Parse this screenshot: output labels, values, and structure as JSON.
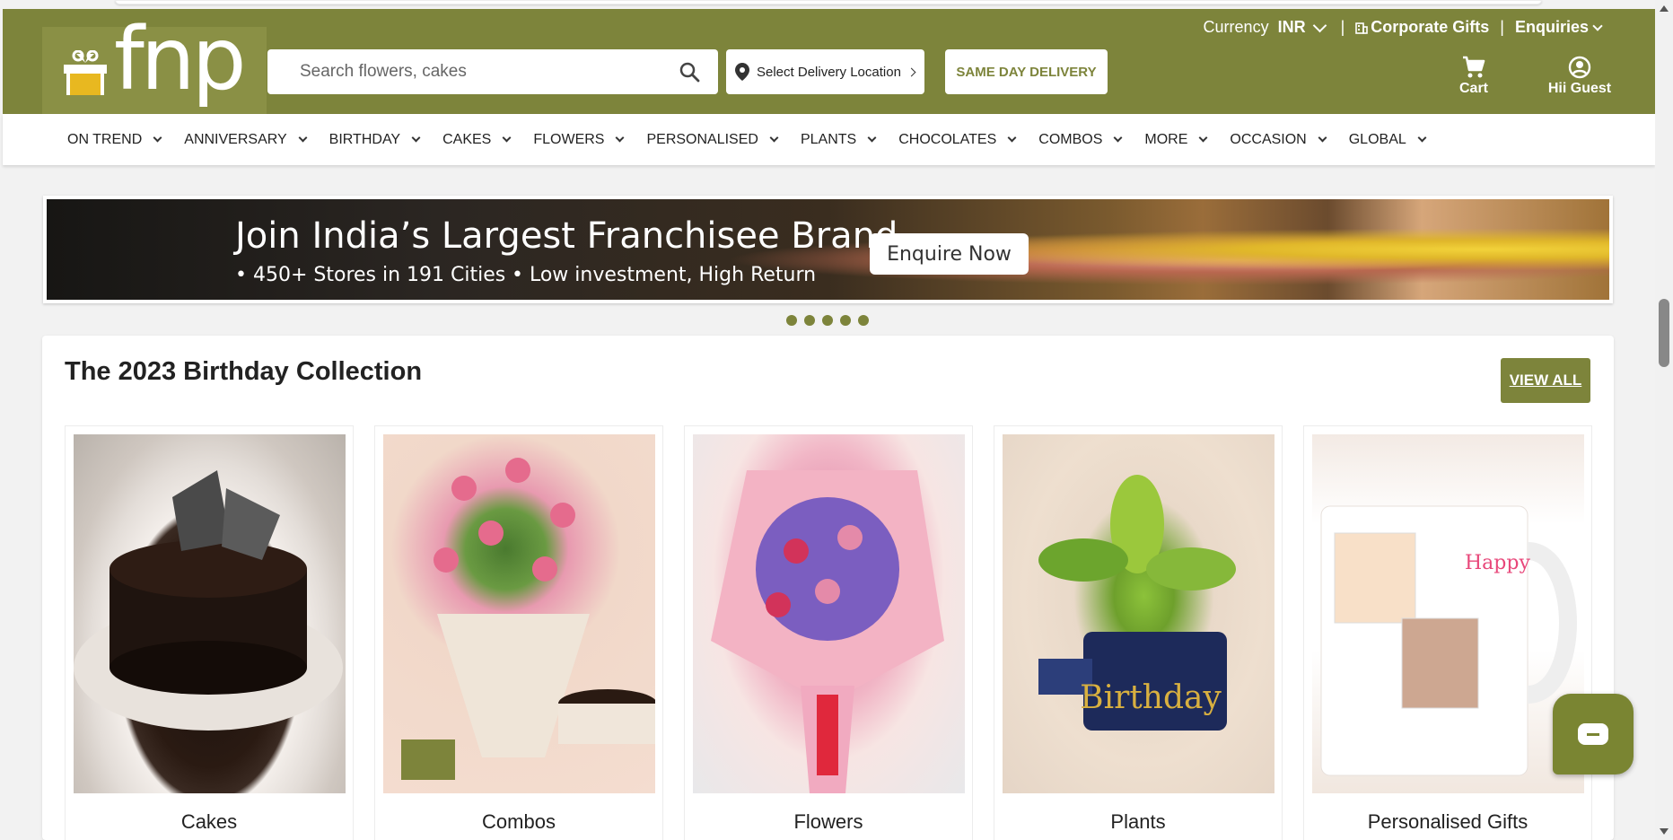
{
  "header": {
    "currency_label": "Currency",
    "currency_value": "INR",
    "corporate_gifts": "Corporate Gifts",
    "enquiries": "Enquiries",
    "logo_text": "fnp",
    "search_placeholder": "Search flowers, cakes",
    "delivery_location": "Select Delivery Location",
    "same_day_delivery": "SAME DAY DELIVERY",
    "cart_label": "Cart",
    "user_label": "Hii Guest",
    "brand_color": "#7d843b"
  },
  "nav": {
    "items": [
      {
        "label": "ON TREND"
      },
      {
        "label": "ANNIVERSARY"
      },
      {
        "label": "BIRTHDAY"
      },
      {
        "label": "CAKES"
      },
      {
        "label": "FLOWERS"
      },
      {
        "label": "PERSONALISED"
      },
      {
        "label": "PLANTS"
      },
      {
        "label": "CHOCOLATES"
      },
      {
        "label": "COMBOS"
      },
      {
        "label": "MORE"
      },
      {
        "label": "OCCASION"
      },
      {
        "label": "GLOBAL"
      }
    ]
  },
  "banner": {
    "headline": "Join India’s Largest Franchisee Brand",
    "bullet_1": "• 450+ Stores in 191 Cities",
    "bullet_2": "• Low investment, High Return",
    "cta": "Enquire Now",
    "dot_count": 5
  },
  "collection": {
    "title": "The 2023 Birthday Collection",
    "view_all": "VIEW ALL",
    "cards": [
      {
        "label": "Cakes"
      },
      {
        "label": "Combos"
      },
      {
        "label": "Flowers"
      },
      {
        "label": "Plants"
      },
      {
        "label": "Personalised Gifts"
      }
    ]
  }
}
